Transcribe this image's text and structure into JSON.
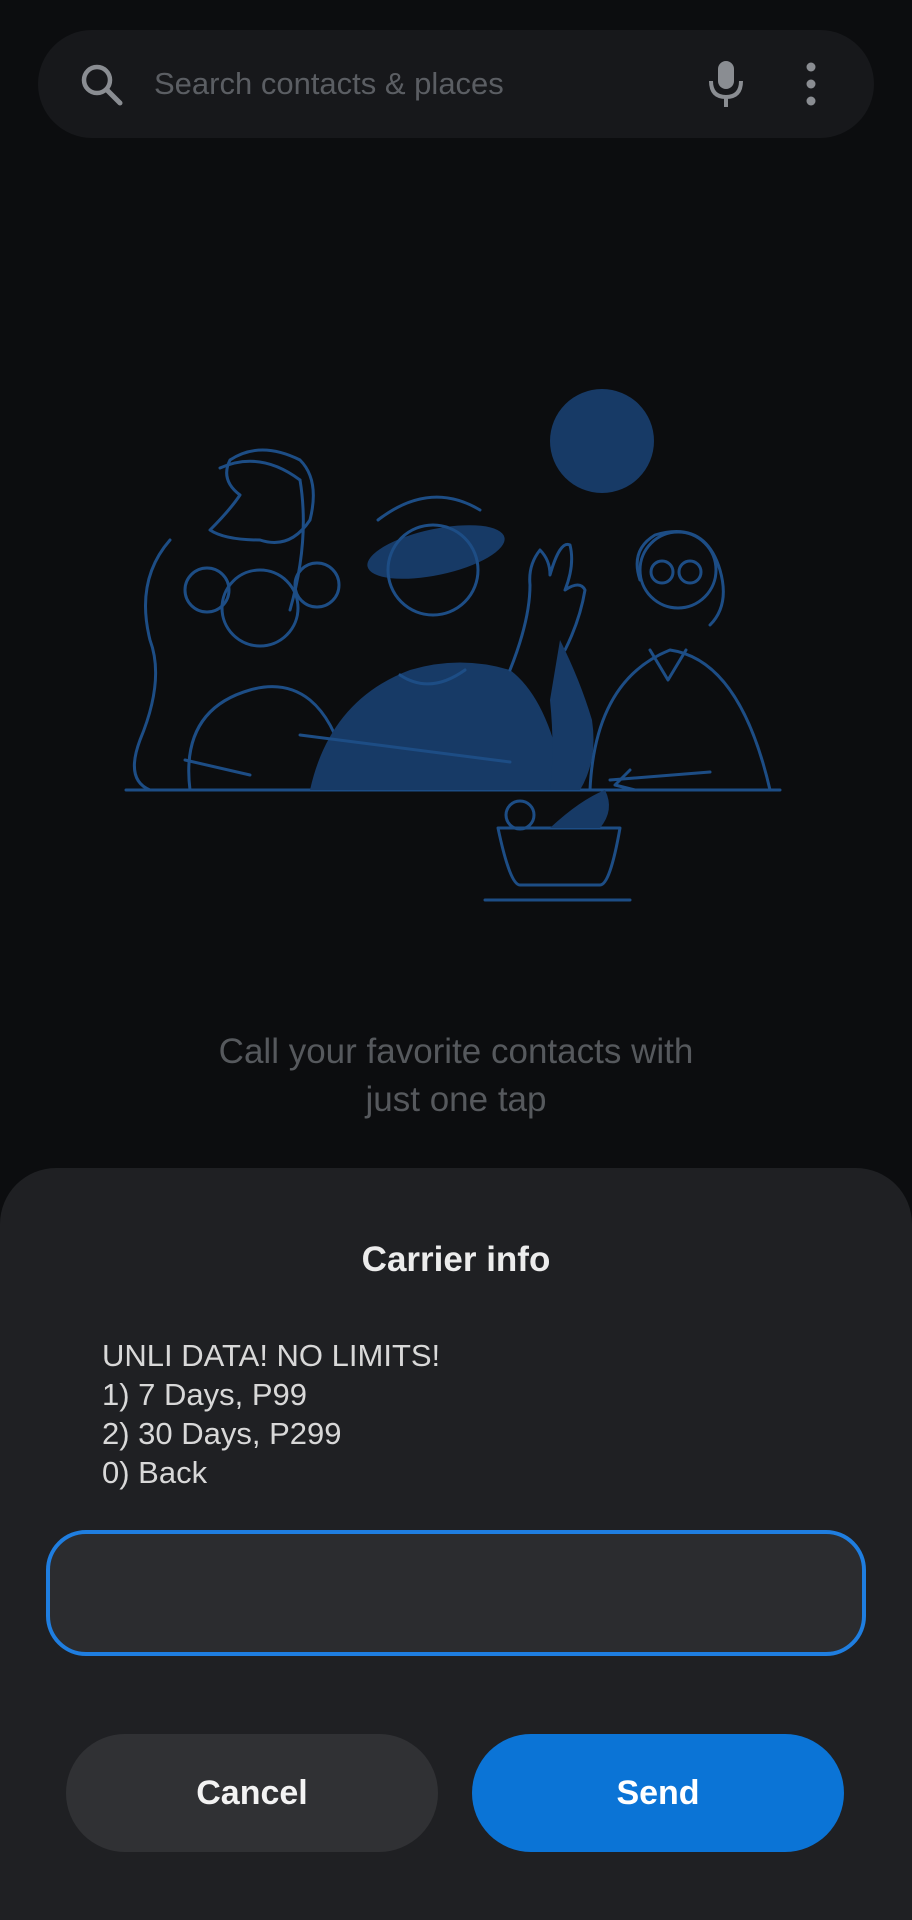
{
  "search": {
    "placeholder": "Search contacts & places",
    "icon": "search-icon",
    "mic_icon": "mic-icon",
    "more_icon": "more-vert-icon"
  },
  "favorites_empty": {
    "illustration": "people-group-illustration",
    "line1": "Call your favorite contacts with",
    "line2": "just one tap"
  },
  "dialog": {
    "title": "Carrier info",
    "message_lines": [
      "UNLI DATA! NO LIMITS!",
      "1) 7 Days, P99",
      "2) 30 Days, P299",
      "0) Back"
    ],
    "input_value": "",
    "cancel_label": "Cancel",
    "send_label": "Send"
  },
  "colors": {
    "background": "#0c0d0f",
    "sheet": "#1f2023",
    "accent": "#0b74d6",
    "illustration": "#173a66"
  }
}
